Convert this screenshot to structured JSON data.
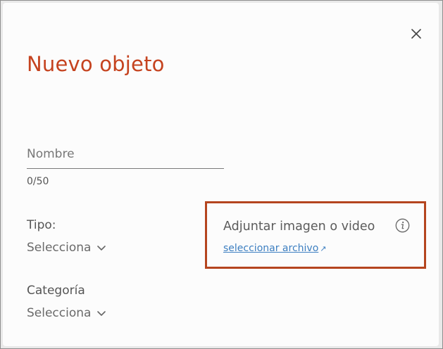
{
  "dialog": {
    "title": "Nuevo objeto",
    "close_icon": "close-icon"
  },
  "name_field": {
    "placeholder": "Nombre",
    "value": "",
    "counter": "0/50"
  },
  "tipo": {
    "label": "Tipo:",
    "value": "Selecciona",
    "icon": "chevron-down-icon"
  },
  "categoria": {
    "label": "Categoría",
    "value": "Selecciona",
    "icon": "chevron-down-icon"
  },
  "attachment": {
    "label": "Adjuntar imagen o video",
    "info_icon": "info-icon",
    "link_label": "seleccionar archivo",
    "link_icon": "external-link-icon",
    "highlight_color": "#b5451f"
  },
  "colors": {
    "title": "#c5431f",
    "link": "#3d7fc1"
  }
}
